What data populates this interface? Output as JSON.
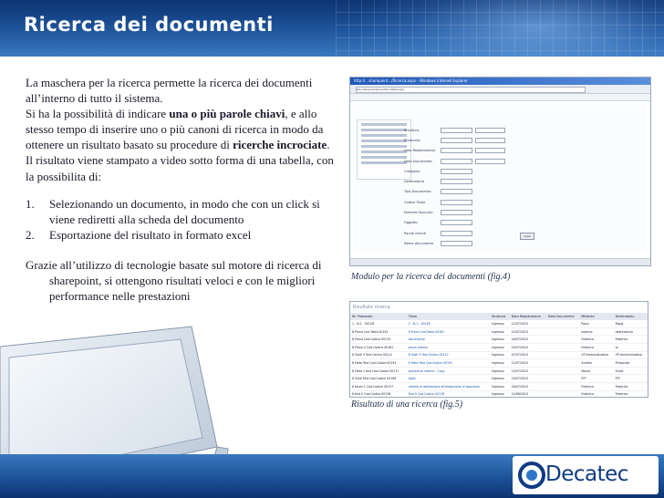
{
  "slide": {
    "title": "Ricerca dei documenti",
    "intro_1": "La maschera per la ricerca permette la ricerca dei documenti all’interno di tutto il sistema.",
    "intro_2_pre": "Si ha la possibilità di indicare ",
    "intro_2_bold": "una o più parole chiavi",
    "intro_2_post": ", e allo stesso tempo di inserire uno o più canoni di ricerca in modo da ottenere un risultato basato su procedure di ",
    "intro_2_bold2": "ricerche incrociate",
    "intro_2_end": ".",
    "intro_3": "Il risultato viene stampato a video sotto forma di una tabella, con la possibilita di:",
    "list": [
      {
        "num": "1.",
        "text": "Selezionando un documento, in modo che con un click si viene rediretti alla scheda del documento"
      },
      {
        "num": "2.",
        "text": "Esportazione del risultato in formato excel"
      }
    ],
    "closing": "Grazie all’utilizzo di tecnologie basate sul motore di ricerca di sharepoint, si ottengono risultati veloci e con le migliori performance nelle prestazioni",
    "caption_fig4": "Modulo per la ricerca dei documenti (fig.4)",
    "caption_fig5": "Risultato di una ricerca (fig.5)",
    "logo_text": "Decatec"
  },
  "fig4": {
    "window_title": "http://...sharepoint.../Ricerca.aspx - Windows Internet Explorer",
    "address": "http://sharepoint/sites/archivio/default.aspx",
    "button": "Cerca",
    "fields": [
      {
        "label": "Struttura",
        "double": true
      },
      {
        "label": "Protocollo",
        "double": true
      },
      {
        "label": "Data Registrazione",
        "double": true
      },
      {
        "label": "Data Documento",
        "double": true
      },
      {
        "label": "Categoria",
        "double": false
      },
      {
        "label": "Destinatario",
        "double": false
      },
      {
        "label": "Tipo Documento",
        "double": false
      },
      {
        "label": "Codice Titolo",
        "double": false
      },
      {
        "label": "Numero Fascicolo",
        "double": false
      },
      {
        "label": "Oggetto",
        "double": false
      },
      {
        "label": "Parole chiave",
        "double": false
      },
      {
        "label": "Nome documento",
        "double": false
      }
    ]
  },
  "fig5": {
    "heading": "Risultato ricerca",
    "columns": [
      "Nr. Protocollo",
      "Titolo",
      "Struttura",
      "Data Registrazione",
      "Data Documento",
      "Mittente",
      "Destinatario"
    ],
    "rows": [
      [
        "1 - N.1 - 00128",
        "1 - N.1 - 00128",
        "Ingresso",
        "12/07/2010",
        "",
        "Rossi",
        "Poggi"
      ],
      [
        "8 Prova Cod.Tabla 00161",
        "8 Prova Cod.Tabla 00161",
        "Ingresso",
        "14/07/2010",
        "",
        "esterno",
        "destinatario"
      ],
      [
        "8 Prova Cod.Codice 00170",
        "documento",
        "Ingresso",
        "16/07/2010",
        "",
        "Federica",
        "Federica"
      ],
      [
        "8 Prova 2 Cod.Codice 00181",
        "prova interna",
        "Ingresso",
        "19/07/2010",
        "",
        "Federico",
        "Io"
      ],
      [
        "8 Gotti 3 Test Centro 00112",
        "6 Gotti 3 Test Centro 00112",
        "Ingresso",
        "07/07/2010",
        "",
        "VP Amministrativo",
        "VP Amministrativo"
      ],
      [
        "8 Fatto Test Cod.Codice 00191",
        "8 Fatto Test Cod.Codice 00191",
        "Ingresso",
        "12/07/2010",
        "",
        "Andrea",
        "Protocollo"
      ],
      [
        "8 Fatto 1 test Cod.Codice 00171",
        "procedura interna - Copy",
        "Ingresso",
        "15/07/2010",
        "",
        "Mauro",
        "Sirals"
      ],
      [
        "8 Gotti Test Cod.Codice 00196",
        "tiptis",
        "Ingresso",
        "19/07/2010",
        "",
        "FFF",
        "FFF"
      ],
      [
        "8 tesmi 1 Cod.Codice 00157",
        "Lettera di Abilitazione all'erogazione di ispezione",
        "Ingresso",
        "16/07/2010",
        "",
        "Federica",
        "Federica"
      ],
      [
        "8 test 0 Cod.Codice 00138",
        "Test 0 Cod.Codice 00138",
        "Ingresso",
        "14/06/2010",
        "",
        "Federica",
        "Federica"
      ]
    ]
  },
  "colors": {
    "header": "#1b4f96",
    "text": "#1a1a2a",
    "caption": "#1d2f4a",
    "logo": "#0f3b85"
  }
}
